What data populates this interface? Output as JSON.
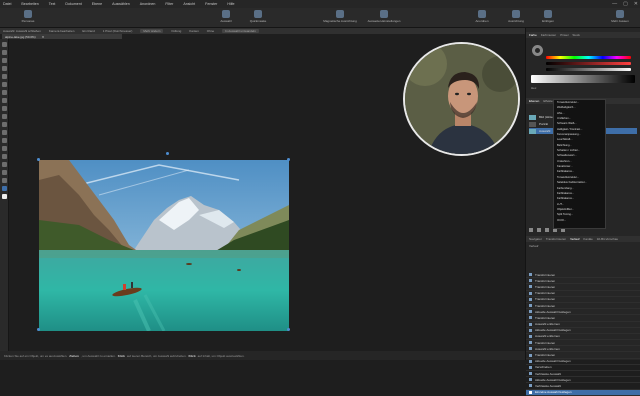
{
  "menubar": {
    "items": [
      "Datei",
      "Bearbeiten",
      "Text",
      "Dokument",
      "Ebene",
      "Auswählen",
      "Anordnen",
      "Filter",
      "Ansicht",
      "Fenster",
      "Hilfe"
    ],
    "controls": [
      "—",
      "▢",
      "✕"
    ]
  },
  "toolbar": {
    "buttons": [
      {
        "label": "Personas",
        "icon": "personas-icon"
      },
      {
        "label": "Auswahl",
        "icon": "selection-icon"
      },
      {
        "label": "Quickmaske",
        "icon": "quickmask-icon"
      },
      {
        "label": "Magnetische Ausrichtung",
        "icon": "snapping-icon"
      },
      {
        "label": "Ausweiten-Einstellungen",
        "icon": "expand-settings-icon"
      },
      {
        "label": "Anordnen",
        "icon": "arrange-icon"
      },
      {
        "label": "Ausrichtung",
        "icon": "align-icon"
      },
      {
        "label": "Einfügen",
        "icon": "insert-icon"
      },
      {
        "label": "Mehr Aussen",
        "icon": "more-icon"
      }
    ]
  },
  "context": {
    "items": [
      "Auswahl: Auswahl schließen",
      "Kamera bearbeiten",
      "Ein Rand",
      "1 Pixel (Durchmesser)"
    ],
    "buttons": [
      "Mehr ändern",
      "Füllung",
      "Kanten",
      "Ohne",
      "In Auswahl umwandeln"
    ]
  },
  "document_tab": {
    "label": "alpine-lake.jpg (50.0%)",
    "close": "✕"
  },
  "right_panel": {
    "top_tabs": [
      "Farbe",
      "Farbmuster",
      "Pinsel",
      "Stock"
    ],
    "hex_label": "Hex",
    "layers_tabs": [
      "Ebenen",
      "Effekte",
      "Stile"
    ],
    "layers": [
      {
        "name": "Bild (Hintergrund)"
      },
      {
        "name": "Porträt"
      },
      {
        "name": "Auswahl"
      }
    ],
    "history_tabs": [
      "Navigator",
      "Transformieren",
      "Verlauf",
      "Kanäle",
      "32-Bit-Vorschau"
    ],
    "history_header": "Verlauf",
    "history": [
      "Transformieren",
      "Transformieren",
      "Transformieren",
      "Transformieren",
      "Transformieren",
      "Transformieren",
      "Aktuelle Auswahl festlegen",
      "Transformieren",
      "Auswahl entfernen",
      "Aktuelle Auswahl festlegen",
      "Auswahl entfernen",
      "Transformieren",
      "Auswahl entfernen",
      "Transformieren",
      "Aktuelle Auswahl festlegen",
      "Verschieben",
      "Verblasste Auswahl",
      "Aktuelle Auswahl festlegen",
      "Verblasste Auswahl",
      "Einzelne Auswahl festlegen"
    ]
  },
  "context_menu": {
    "items": [
      "Tonwertkorrektur...",
      "Weißabgleich...",
      "HSL...",
      "Umfärben...",
      "Schwarz-Weiß...",
      "Helligkeit / Kontrast...",
      "Kurvenanpassung...",
      "Leuchtkraft...",
      "Belichtung...",
      "Schatten / Lichter...",
      "Schwellenwert...",
      "Umkehren...",
      "Kanalmixer...",
      "Farbbalance...",
      "Tonwertkorrektur...",
      "Selektive Farbkorrektur...",
      "Farbumfang...",
      "Farbbalance...",
      "Farbbalance...",
      "LUT...",
      "Objektivfilter...",
      "Split Toning...",
      "OCIO..."
    ]
  },
  "status": {
    "prefix": "Klicken Sie auf ein Objekt, um es auszuwählen.",
    "b1": "Ziehen",
    "t1": ", um Auswahl zu erstellen.",
    "b2": "Klick",
    "t2": "auf leeren Bereich, um Auswahl aufzuheben.",
    "b3": "Klick",
    "t3": "auf Inhalt, um Objekt auszuwählen."
  },
  "colors": {
    "accent": "#3e6ea8",
    "history_active": "#3e6ea8",
    "panel_bg": "#262626",
    "canvas_bg": "#1e1e1e"
  }
}
